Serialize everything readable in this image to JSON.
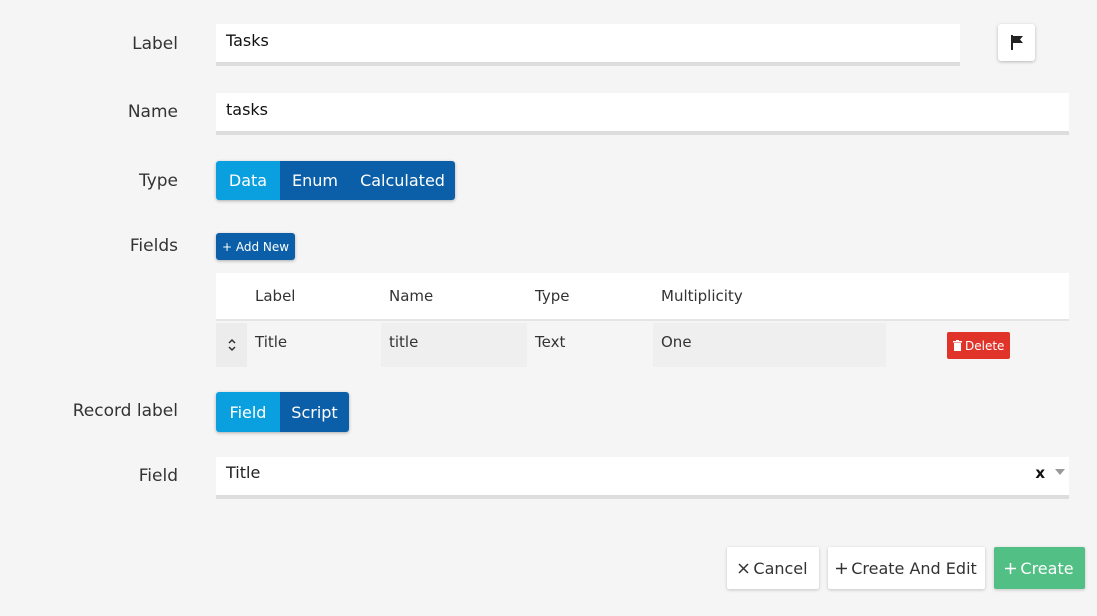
{
  "form": {
    "label": {
      "title": "Label",
      "value": "Tasks"
    },
    "name": {
      "title": "Name",
      "value": "tasks"
    },
    "type": {
      "title": "Type",
      "options": [
        "Data",
        "Enum",
        "Calculated"
      ],
      "selected": "Data"
    },
    "fields": {
      "title": "Fields",
      "add_new": "+ Add New",
      "columns": [
        "Label",
        "Name",
        "Type",
        "Multiplicity"
      ],
      "rows": [
        {
          "label": "Title",
          "name": "title",
          "type": "Text",
          "multiplicity": "One",
          "delete": "Delete"
        }
      ]
    },
    "record_label": {
      "title": "Record label",
      "options": [
        "Field",
        "Script"
      ],
      "selected": "Field"
    },
    "field": {
      "title": "Field",
      "value": "Title",
      "clear": "x"
    }
  },
  "footer": {
    "cancel": "Cancel",
    "create_and_edit": "Create And Edit",
    "create": "Create"
  },
  "colors": {
    "segment_active": "#0a9fdf",
    "segment_inactive": "#0a5fa8",
    "delete": "#e0342b",
    "create": "#52bf85"
  }
}
